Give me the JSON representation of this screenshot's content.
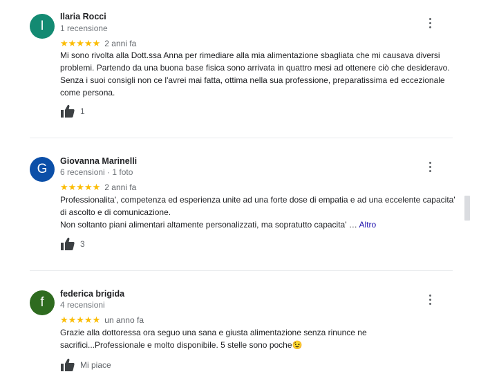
{
  "reviews": [
    {
      "initial": "I",
      "avatar_color": "#138a72",
      "name": "Ilaria Rocci",
      "meta": "1 recensione",
      "stars": "★★★★★",
      "time": "2 anni fa",
      "text": "Mi sono rivolta alla Dott.ssa Anna per rimediare alla mia alimentazione sbagliata che mi causava diversi problemi. Partendo da una buona base fisica sono arrivata in quattro mesi ad ottenere ciò che desideravo. Senza i suoi consigli non ce l'avrei mai fatta, ottima nella sua professione, preparatissima ed eccezionale come persona.",
      "likes": "1"
    },
    {
      "initial": "G",
      "avatar_color": "#0b4fa8",
      "name": "Giovanna Marinelli",
      "meta": "6 recensioni · 1 foto",
      "stars": "★★★★★",
      "time": "2 anni fa",
      "text_line1": "Professionalita', competenza ed esperienza unite ad una forte dose di empatia e ad una eccelente capacita' di ascolto e di comunicazione.",
      "text_line2": "Non soltanto piani alimentari altamente personalizzati, ma sopratutto capacita' …",
      "more_label": "Altro",
      "likes": "3"
    },
    {
      "initial": "f",
      "avatar_color": "#2e6b1f",
      "name": "federica brigida",
      "meta": "4 recensioni",
      "stars": "★★★★★",
      "time": "un anno fa",
      "text": "Grazie alla dottoressa ora seguo una sana e giusta alimentazione senza rinunce ne sacrifici...Professionale e molto disponibile. 5 stelle sono poche😉",
      "likes": "Mi piace"
    }
  ],
  "colors": {
    "star": "#fbbc04",
    "link": "#1a0dab",
    "meta": "#70757a"
  }
}
